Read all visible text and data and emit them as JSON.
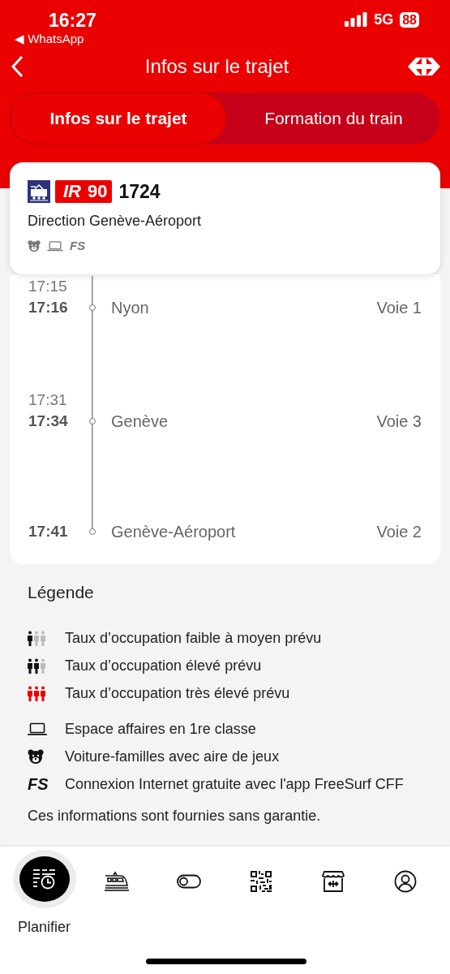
{
  "status_bar": {
    "time": "16:27",
    "back_app": "◀ WhatsApp",
    "network": "5G",
    "battery": "88"
  },
  "nav": {
    "title": "Infos sur le trajet"
  },
  "tabs": [
    {
      "label": "Infos sur le trajet",
      "selected": true
    },
    {
      "label": "Formation du train",
      "selected": false
    }
  ],
  "train": {
    "product": "IR",
    "line": "90",
    "number": "1724",
    "direction": "Direction Genève-Aéroport",
    "amenities": [
      {
        "kind": "family"
      },
      {
        "kind": "laptop"
      },
      {
        "kind": "freesurf",
        "label": "FS"
      }
    ]
  },
  "stops": [
    {
      "planned": "17:15",
      "actual": "17:16",
      "name": "Nyon",
      "platform": "Voie 1"
    },
    {
      "planned": "17:31",
      "actual": "17:34",
      "name": "Genève",
      "platform": "Voie 3"
    },
    {
      "actual": "17:41",
      "name": "Genève-Aéroport",
      "platform": "Voie 2"
    }
  ],
  "legend": {
    "title": "Légende",
    "groups": [
      [
        {
          "kind": "occupancy_low",
          "text": "Taux d’occupation faible à moyen prévu"
        },
        {
          "kind": "occupancy_high",
          "text": "Taux d’occupation élevé prévu"
        },
        {
          "kind": "occupancy_very_high",
          "text": "Taux d’occupation très élevé prévu"
        }
      ],
      [
        {
          "kind": "laptop",
          "text": "Espace affaires en 1re classe"
        },
        {
          "kind": "family",
          "text": "Voiture-familles avec aire de jeux"
        },
        {
          "kind": "freesurf",
          "label": "FS",
          "text": "Connexion Internet gratuite avec l'app FreeSurf CFF"
        }
      ]
    ],
    "note": "Ces informations sont fournies sans garantie."
  },
  "bottom_nav": [
    {
      "kind": "planner",
      "label": "Planifier",
      "selected": true
    },
    {
      "kind": "train",
      "selected": false
    },
    {
      "kind": "toggle",
      "selected": false
    },
    {
      "kind": "qr",
      "selected": false
    },
    {
      "kind": "shop",
      "selected": false
    },
    {
      "kind": "profile",
      "selected": false
    }
  ]
}
